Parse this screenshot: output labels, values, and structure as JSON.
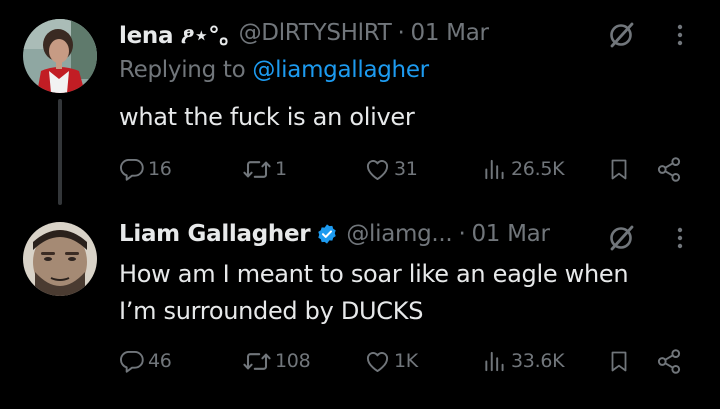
{
  "colors": {
    "background": "#000000",
    "primary_text": "#e7e9ea",
    "secondary_text": "#71767b",
    "link": "#1d9bf0",
    "verified": "#1d9bf0",
    "thread_line": "#333639"
  },
  "tweets": [
    {
      "display_name": "lena ፆ⋆°｡",
      "handle": "@DlRTYSHlRT",
      "separator": "·",
      "date": "01 Mar",
      "replying_prefix": "Replying to ",
      "replying_handle": "@liamgallagher",
      "text_lines": [
        "what the fuck is an oliver"
      ],
      "verified": false,
      "metrics": {
        "replies": "16",
        "reposts": "1",
        "likes": "31",
        "views": "26.5K"
      },
      "icons": [
        "grok-icon",
        "more-icon",
        "reply-icon",
        "repost-icon",
        "like-icon",
        "views-icon",
        "bookmark-icon",
        "share-icon"
      ]
    },
    {
      "display_name": "Liam Gallagher",
      "handle": "@liamg...",
      "separator": "·",
      "date": "01 Mar",
      "text_lines": [
        "How am I meant to soar like an eagle when",
        "I’m surrounded by DUCKS"
      ],
      "verified": true,
      "metrics": {
        "replies": "46",
        "reposts": "108",
        "likes": "1K",
        "views": "33.6K"
      },
      "icons": [
        "verified-badge-icon",
        "grok-icon",
        "more-icon",
        "reply-icon",
        "repost-icon",
        "like-icon",
        "views-icon",
        "bookmark-icon",
        "share-icon"
      ]
    }
  ]
}
